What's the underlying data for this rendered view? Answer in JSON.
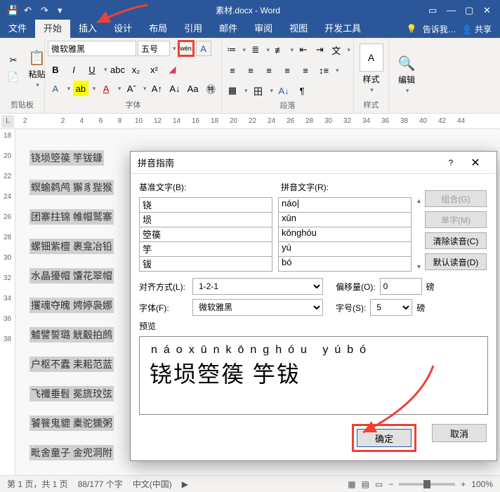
{
  "title": "素材.docx - Word",
  "menus": {
    "file": "文件",
    "home": "开始",
    "insert": "插入",
    "design": "设计",
    "layout": "布局",
    "references": "引用",
    "mail": "邮件",
    "review": "审阅",
    "view": "视图",
    "developer": "开发工具",
    "tell": "告诉我…",
    "share": "共享"
  },
  "ribbon": {
    "clipboard": {
      "paste": "粘贴",
      "label": "剪贴板"
    },
    "font": {
      "name": "微软雅黑",
      "size": "五号",
      "phonetic": "wén",
      "label": "字体"
    },
    "paragraph": {
      "label": "段落"
    },
    "styles": {
      "btn": "样式",
      "label": "样式"
    },
    "editing": {
      "btn": "编辑"
    }
  },
  "ruler": {
    "ticks": [
      "2",
      "",
      "2",
      "4",
      "6",
      "8",
      "10",
      "12",
      "14",
      "16",
      "18",
      "20",
      "22",
      "24",
      "26",
      "28",
      "30",
      "32",
      "34",
      "36",
      "38",
      "40",
      "42",
      "44"
    ]
  },
  "vruler": [
    "18",
    "20",
    "22",
    "24",
    "26",
    "28",
    "30",
    "32",
    "34",
    "36",
    "38"
  ],
  "lines": [
    "铙埙箜篌  竽钹鏮",
    "螟蝓鹈鸬  獬豸狴猴",
    "团寨拄锦  帷帽鹫寨",
    "螺钿紫檀  裹龛冶铅",
    "水晶獶帽  馕花翠帽",
    "攫魂夺魄  娉婷袅娜",
    "魖譬誓璐  觥觳拍鹧",
    "户枢不蠹  耒耜范蓝",
    "飞襳垂髫  冕旒玟弦",
    "饕餮鬼貔  橐驼獯粥",
    "毗舍童子  金兜洞附"
  ],
  "dlg": {
    "title": "拼音指南",
    "baseLabel": "基准文字(B):",
    "pinyinLabel": "拼音文字(R):",
    "base": [
      "铙",
      "埙",
      "箜篌",
      "竽",
      "钹"
    ],
    "pinyin": [
      "náo",
      "xūn",
      "kōnghóu",
      "yú",
      "bó"
    ],
    "sideBtns": {
      "combine": "组合(G)",
      "single": "单字(M)",
      "clear": "清除读音(C)",
      "default": "默认读音(D)"
    },
    "alignLabel": "对齐方式(L):",
    "alignVal": "1-2-1",
    "offsetLabel": "偏移量(O):",
    "offsetVal": "0",
    "offsetUnit": "磅",
    "fontLabel": "字体(F):",
    "fontVal": "微软雅黑",
    "fsizeLabel": "字号(S):",
    "fsizeVal": "5",
    "fsizeUnit": "磅",
    "previewLabel": "预览",
    "previewPinyin": "náoxūnkōnghóu yúbó",
    "previewHanzi": "铙埙箜篌  竽钹",
    "ok": "确定",
    "cancel": "取消",
    "help": "?"
  },
  "status": {
    "page": "第 1 页，共 1 页",
    "words": "88/177 个字",
    "lang": "中文(中国)",
    "zoom": "100%"
  }
}
